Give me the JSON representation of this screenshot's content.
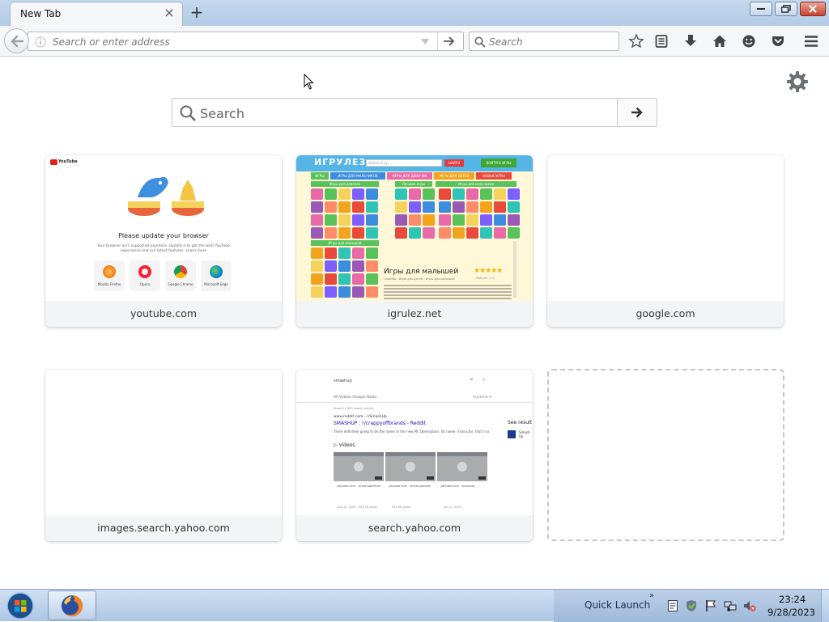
{
  "window": {
    "tab_title": "New Tab",
    "new_tab_symbol": "+",
    "minimize_icon": "minimize-icon",
    "maximize_icon": "restore-icon",
    "close_icon": "close-icon"
  },
  "navbar": {
    "url_placeholder": "Search or enter address",
    "search_placeholder": "Search",
    "icons": [
      "back-arrow-icon",
      "info-icon",
      "dropdown-icon",
      "go-arrow-icon",
      "search-icon",
      "bookmark-star-icon",
      "reading-list-icon",
      "download-icon",
      "home-icon",
      "hello-icon",
      "pocket-icon",
      "hamburger-menu-icon"
    ]
  },
  "content": {
    "search_placeholder": "Search",
    "settings_icon": "gear-icon",
    "tiles": [
      {
        "label": "youtube.com"
      },
      {
        "label": "igrulez.net"
      },
      {
        "label": "google.com"
      },
      {
        "label": "images.search.yahoo.com"
      },
      {
        "label": "search.yahoo.com"
      }
    ],
    "empty_tile": true
  },
  "thumbs": {
    "youtube": {
      "logo_text": "YouTube",
      "title": "Please update your browser",
      "body": "Your browser isn't supported anymore. Update it to get the best YouTube experience and our latest features. Learn more",
      "browsers": [
        "Mozilla Firefox",
        "Opera",
        "Google Chrome",
        "Microsoft Edge"
      ]
    },
    "igrulez": {
      "logo": "ИГРУЛЕЗ",
      "search_hint": "Найти игру...",
      "find_btn": "НАЙТИ",
      "login_btn": "ВОЙТИ В ИГРЫ",
      "nav": [
        "ИГРЫ",
        "ИГРЫ ДЛЯ МАЛЬЧИКОВ",
        "ИГРЫ ДЛЯ ДЕВОЧЕК",
        "ИГРЫ ДЛЯ ДЕТЕЙ",
        "НОВЫЕ ИГРЫ"
      ],
      "sections": [
        "Игры для девочек",
        "Лучшие игры",
        "Игры для мальчиков",
        "Игры для малышей"
      ],
      "game_title": "Игры для малышей",
      "rating": "★★★★★",
      "rating_caption": "Рейтинг: 4.5",
      "crumb": "Главная › Игры для детей › Игры для малышей"
    },
    "search_yahoo": {
      "query": "smashup",
      "tabs": "All   Videos   Images   News",
      "tools": "Anytime ▾",
      "about": "About 11,600 search results",
      "url": "www.reddit.com › r/SmashUp",
      "link": "SMASHUP : r/crappyoffbrands - Reddit",
      "snippet": "There definitely going to be the name of the new Mr. Domination. Sit name. Instructor, that's so",
      "see_results": "See result",
      "side_caption": "Smash Up",
      "videos": "Videos",
      "video_caps": [
        "youtube.com · smashupofficial",
        "youtube.com · smashupvideo",
        "youtube.com · smashup"
      ],
      "bottom": [
        "Aug 13, 2020 · 233.7K views",
        "361.6K views",
        "Jun 17, 2021"
      ]
    }
  },
  "taskbar": {
    "quick_launch_label": "Quick Launch",
    "chevron": "»",
    "time": "23:24",
    "date": "9/28/2023",
    "tray_icons": [
      "clipboard-icon",
      "security-shield-icon",
      "action-center-flag-icon",
      "network-icon",
      "volume-muted-icon"
    ]
  },
  "colors": {
    "tab_strip": "#c4d8ee",
    "toolbar": "#f5f6f7",
    "taskbar": "#b9cfe8",
    "tile_label_bg": "#f3f4f5",
    "youtube_red": "#e62117",
    "link_blue": "#1a0dab"
  }
}
